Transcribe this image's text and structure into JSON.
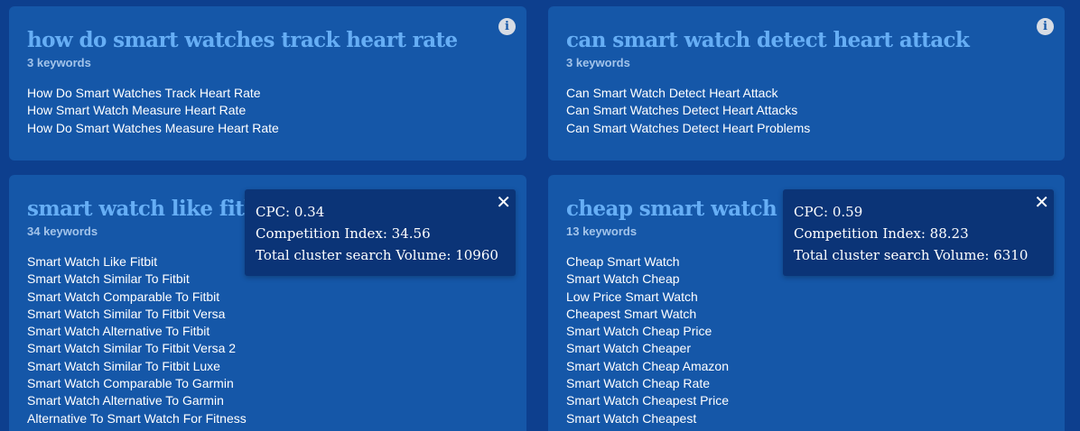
{
  "cards": [
    {
      "title": "how do smart watches track heart rate",
      "count": "3 keywords",
      "keywords": [
        "How Do Smart Watches Track Heart Rate",
        "How Smart Watch Measure Heart Rate",
        "How Do Smart Watches Measure Heart Rate"
      ]
    },
    {
      "title": "can smart watch detect heart attack",
      "count": "3 keywords",
      "keywords": [
        "Can Smart Watch Detect Heart Attack",
        "Can Smart Watches Detect Heart Attacks",
        "Can Smart Watches Detect Heart Problems"
      ]
    },
    {
      "title": "smart watch like fitbit",
      "count": "34 keywords",
      "keywords": [
        "Smart Watch Like Fitbit",
        "Smart Watch Similar To Fitbit",
        "Smart Watch Comparable To Fitbit",
        "Smart Watch Similar To Fitbit Versa",
        "Smart Watch Alternative To Fitbit",
        "Smart Watch Similar To Fitbit Versa 2",
        "Smart Watch Similar To Fitbit Luxe",
        "Smart Watch Comparable To Garmin",
        "Smart Watch Alternative To Garmin",
        "Alternative To Smart Watch For Fitness"
      ]
    },
    {
      "title": "cheap smart watch",
      "count": "13 keywords",
      "keywords": [
        "Cheap Smart Watch",
        "Smart Watch Cheap",
        "Low Price Smart Watch",
        "Cheapest Smart Watch",
        "Smart Watch Cheap Price",
        "Smart Watch Cheaper",
        "Smart Watch Cheap Amazon",
        "Smart Watch Cheap Rate",
        "Smart Watch Cheapest Price",
        "Smart Watch Cheapest"
      ]
    }
  ],
  "tooltips": [
    {
      "cpc": "CPC: 0.34",
      "competition": "Competition Index: 34.56",
      "volume": "Total cluster search Volume: 10960"
    },
    {
      "cpc": "CPC: 0.59",
      "competition": "Competition Index: 88.23",
      "volume": "Total cluster search Volume: 6310"
    }
  ],
  "icons": {
    "info": "i",
    "close": "✕"
  },
  "colors": {
    "background": "#0d3f8e",
    "card": "#1557a8",
    "title": "#66aef5",
    "tooltip": "#0b3477"
  }
}
